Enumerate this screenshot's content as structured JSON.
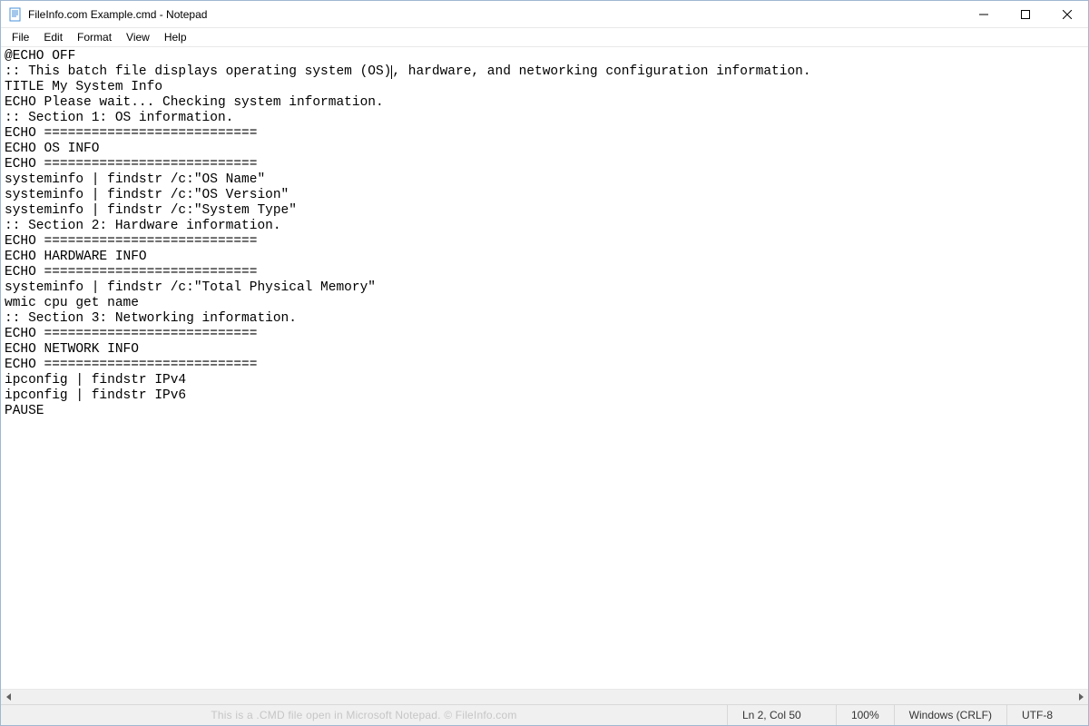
{
  "window": {
    "title": "FileInfo.com Example.cmd - Notepad"
  },
  "menu": {
    "items": [
      "File",
      "Edit",
      "Format",
      "View",
      "Help"
    ]
  },
  "document": {
    "lines": [
      "@ECHO OFF",
      ":: This batch file displays operating system (OS), hardware, and networking configuration information.",
      "TITLE My System Info",
      "ECHO Please wait... Checking system information.",
      ":: Section 1: OS information.",
      "ECHO ===========================",
      "ECHO OS INFO",
      "ECHO ===========================",
      "systeminfo | findstr /c:\"OS Name\"",
      "systeminfo | findstr /c:\"OS Version\"",
      "systeminfo | findstr /c:\"System Type\"",
      ":: Section 2: Hardware information.",
      "ECHO ===========================",
      "ECHO HARDWARE INFO",
      "ECHO ===========================",
      "systeminfo | findstr /c:\"Total Physical Memory\"",
      "wmic cpu get name",
      ":: Section 3: Networking information.",
      "ECHO ===========================",
      "ECHO NETWORK INFO",
      "ECHO ===========================",
      "ipconfig | findstr IPv4",
      "ipconfig | findstr IPv6",
      "PAUSE"
    ],
    "caret_line_index": 1,
    "caret_col": 50
  },
  "status": {
    "watermark": "This is a .CMD file open in Microsoft Notepad. © FileInfo.com",
    "position": "Ln 2, Col 50",
    "zoom": "100%",
    "line_ending": "Windows (CRLF)",
    "encoding": "UTF-8"
  },
  "icons": {
    "minimize": "—",
    "maximize": "☐",
    "close": "✕",
    "left_arrow": "◀",
    "right_arrow": "▶"
  }
}
